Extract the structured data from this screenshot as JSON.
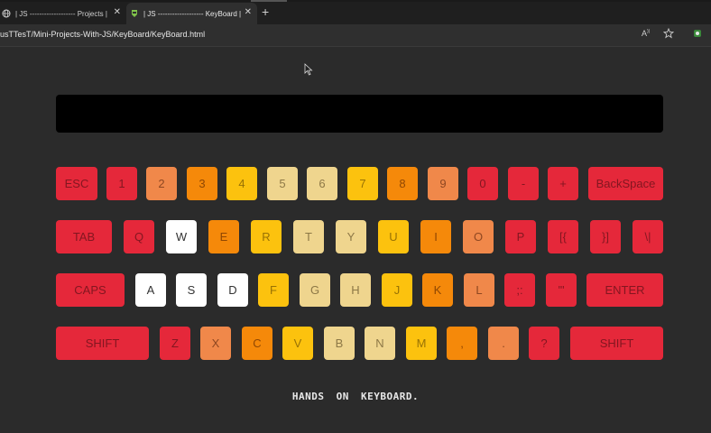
{
  "browser": {
    "tabs": [
      {
        "label": "| JS ------------------- Projects |",
        "icon": "globe-icon",
        "active": false
      },
      {
        "label": "| JS ------------------- KeyBoard |",
        "icon": "page-favicon-icon",
        "active": true
      }
    ],
    "close_glyph": "✕",
    "new_tab_glyph": "+",
    "url": "usTTesT/Mini-Projects-With-JS/KeyBoard/KeyBoard.html",
    "icons": [
      "read-aloud-icon",
      "favorite-star-icon",
      "extension-icon"
    ]
  },
  "keyboard": {
    "row1": [
      {
        "label": "ESC",
        "color": "#e5283a"
      },
      {
        "label": "1",
        "color": "#e5283a"
      },
      {
        "label": "2",
        "color": "#f0884a"
      },
      {
        "label": "3",
        "color": "#f5890a"
      },
      {
        "label": "4",
        "color": "#fcc20e"
      },
      {
        "label": "5",
        "color": "#efd58e"
      },
      {
        "label": "6",
        "color": "#efd58e"
      },
      {
        "label": "7",
        "color": "#fcc20e"
      },
      {
        "label": "8",
        "color": "#f5890a"
      },
      {
        "label": "9",
        "color": "#f0884a"
      },
      {
        "label": "0",
        "color": "#e5283a"
      },
      {
        "label": "-",
        "color": "#e5283a"
      },
      {
        "label": "+",
        "color": "#e5283a"
      },
      {
        "label": "BackSpace",
        "color": "#e5283a"
      }
    ],
    "row2": [
      {
        "label": "TAB",
        "color": "#e5283a"
      },
      {
        "label": "Q",
        "color": "#e5283a"
      },
      {
        "label": "W",
        "color": "#ffffff"
      },
      {
        "label": "E",
        "color": "#f5890a"
      },
      {
        "label": "R",
        "color": "#fcc20e"
      },
      {
        "label": "T",
        "color": "#efd58e"
      },
      {
        "label": "Y",
        "color": "#efd58e"
      },
      {
        "label": "U",
        "color": "#fcc20e"
      },
      {
        "label": "I",
        "color": "#f5890a"
      },
      {
        "label": "O",
        "color": "#f0884a"
      },
      {
        "label": "P",
        "color": "#e5283a"
      },
      {
        "label": "[{",
        "color": "#e5283a"
      },
      {
        "label": "}]",
        "color": "#e5283a"
      },
      {
        "label": "\\|",
        "color": "#e5283a"
      }
    ],
    "row3": [
      {
        "label": "CAPS",
        "color": "#e5283a"
      },
      {
        "label": "A",
        "color": "#ffffff"
      },
      {
        "label": "S",
        "color": "#ffffff"
      },
      {
        "label": "D",
        "color": "#ffffff"
      },
      {
        "label": "F",
        "color": "#fcc20e"
      },
      {
        "label": "G",
        "color": "#efd58e"
      },
      {
        "label": "H",
        "color": "#efd58e"
      },
      {
        "label": "J",
        "color": "#fcc20e"
      },
      {
        "label": "K",
        "color": "#f5890a"
      },
      {
        "label": "L",
        "color": "#f0884a"
      },
      {
        "label": ";:",
        "color": "#e5283a"
      },
      {
        "label": "'\"",
        "color": "#e5283a"
      },
      {
        "label": "ENTER",
        "color": "#e5283a"
      }
    ],
    "row4": [
      {
        "label": "SHIFT",
        "color": "#e5283a"
      },
      {
        "label": "Z",
        "color": "#e5283a"
      },
      {
        "label": "X",
        "color": "#f0884a"
      },
      {
        "label": "C",
        "color": "#f5890a"
      },
      {
        "label": "V",
        "color": "#fcc20e"
      },
      {
        "label": "B",
        "color": "#efd58e"
      },
      {
        "label": "N",
        "color": "#efd58e"
      },
      {
        "label": "M",
        "color": "#fcc20e"
      },
      {
        "label": ",",
        "color": "#f5890a"
      },
      {
        "label": ".",
        "color": "#f0884a"
      },
      {
        "label": "?",
        "color": "#e5283a"
      },
      {
        "label": "SHIFT",
        "color": "#e5283a"
      }
    ]
  },
  "footer": {
    "text": "HANDS ON KEYBOARD."
  }
}
